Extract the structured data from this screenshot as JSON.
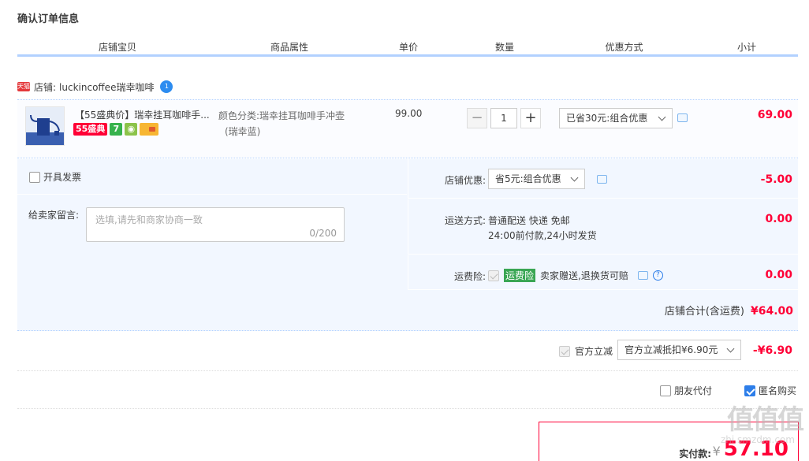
{
  "page_title": "确认订单信息",
  "headers": [
    "店铺宝贝",
    "商品属性",
    "单价",
    "数量",
    "优惠方式",
    "小计"
  ],
  "shop": {
    "badge": "天猫",
    "label": "店铺:",
    "name": "luckincoffee瑞幸咖啡",
    "chat_badge": "1"
  },
  "item": {
    "title": "【55盛典价】瑞幸挂耳咖啡手...",
    "badges": {
      "sale": "55盛典",
      "seven": "7"
    },
    "attr_line1": "颜色分类:瑞幸挂耳咖啡手冲壶",
    "attr_line2": "(瑞幸蓝)",
    "price": "99.00",
    "quantity": "1",
    "minus": "−",
    "plus": "+",
    "discount": "已省30元:组合优惠",
    "subtotal": "69.00"
  },
  "invoice": {
    "label": "开具发票"
  },
  "message": {
    "label": "给卖家留言:",
    "placeholder": "选填,请先和商家协商一致",
    "count": "0/200"
  },
  "shop_discount": {
    "label": "店铺优惠:",
    "value": "省5元:组合优惠",
    "amount": "-5.00"
  },
  "shipping": {
    "label": "运送方式:",
    "line1": "普通配送 快递 免邮",
    "line2": "24:00前付款,24小时发货",
    "amount": "0.00"
  },
  "insurance": {
    "label": "运费险:",
    "tag": "运费险",
    "text": "卖家赠送,退换货可赔",
    "amount": "0.00"
  },
  "shop_total": {
    "label": "店铺合计(含运费)",
    "amount": "¥64.00"
  },
  "official": {
    "label": "官方立减",
    "value": "官方立减抵扣¥6.90元",
    "amount": "-¥6.90"
  },
  "friend_pay": {
    "label": "朋友代付"
  },
  "anonymous": {
    "label": "匿名购买"
  },
  "pay": {
    "label": "实付款:",
    "currency": "¥",
    "amount": "57.10"
  },
  "watermark": {
    "big": "值值值",
    "small": "zhi.smzdm.com"
  },
  "colors": {
    "accent": "#ff0036",
    "header_line": "#b2d1ff",
    "panel": "#f2f7ff"
  }
}
